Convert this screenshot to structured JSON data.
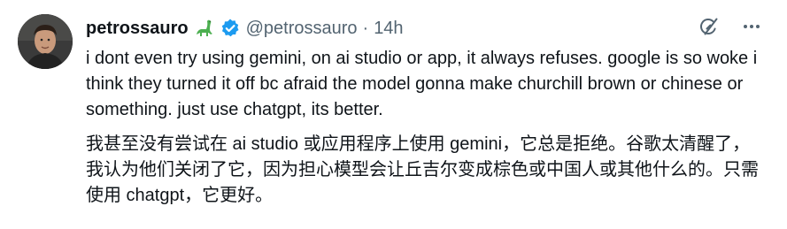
{
  "tweet": {
    "author": {
      "display_name": "petrossauro",
      "name_emoji": "sauropod-emoji-icon",
      "verified": true,
      "handle": "@petrossauro",
      "separator": "·",
      "timestamp": "14h"
    },
    "original_text": "i dont even try using gemini, on ai studio or app, it always refuses. google is so woke i think they turned it off bc afraid the model gonna make churchill brown or chinese or something. just use chatgpt, its better.",
    "translated_text": "我甚至没有尝试在 ai studio 或应用程序上使用 gemini，它总是拒绝。谷歌太清醒了，我认为他们关闭了它，因为担心模型会让丘吉尔变成棕色或中国人或其他什么的。只需使用 chatgpt，它更好。",
    "actions": {
      "grok_icon": "grok-icon",
      "more_icon": "more-options-icon"
    }
  },
  "colors": {
    "text_primary": "#0f1419",
    "text_secondary": "#536471",
    "verified_blue": "#1d9bf0",
    "emoji_green": "#4caf50"
  }
}
